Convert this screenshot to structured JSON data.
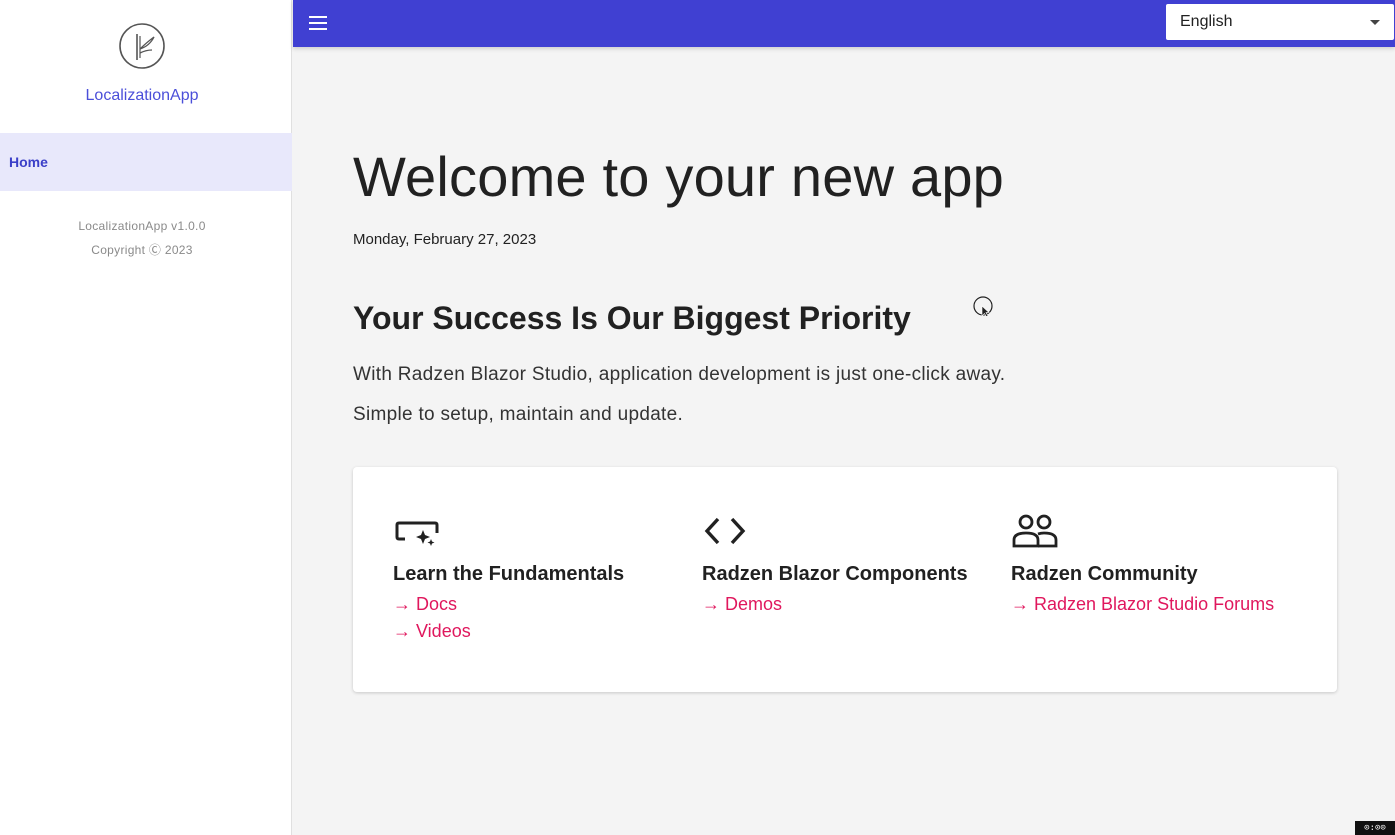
{
  "app": {
    "name": "LocalizationApp",
    "version_text": "LocalizationApp v1.0.0",
    "copyright_text": "Copyright Ⓒ 2023"
  },
  "sidebar": {
    "items": [
      {
        "label": "Home",
        "active": true
      }
    ]
  },
  "header": {
    "menu_icon": "hamburger-menu-icon",
    "language": {
      "selected": "English"
    }
  },
  "main": {
    "title": "Welcome to your new app",
    "date": "Monday, February 27, 2023",
    "subtitle": "Your Success Is Our Biggest Priority",
    "paragraphs": [
      "With Radzen Blazor Studio, application development is just one-click away.",
      "Simple to setup, maintain and update."
    ],
    "card": {
      "columns": [
        {
          "icon": "magic-button-icon",
          "title": "Learn the Fundamentals",
          "links": [
            "→ Docs",
            "→ Videos"
          ]
        },
        {
          "icon": "code-icon",
          "title": "Radzen Blazor Components",
          "links": [
            "→ Demos"
          ]
        },
        {
          "icon": "group-icon",
          "title": "Radzen Community",
          "links": [
            "→ Radzen Blazor Studio Forums"
          ]
        }
      ]
    }
  },
  "colors": {
    "header_bg": "#4040d2",
    "accent": "#4b4fd9",
    "link": "#e0175d",
    "nav_active_bg": "#e8e8fb"
  }
}
